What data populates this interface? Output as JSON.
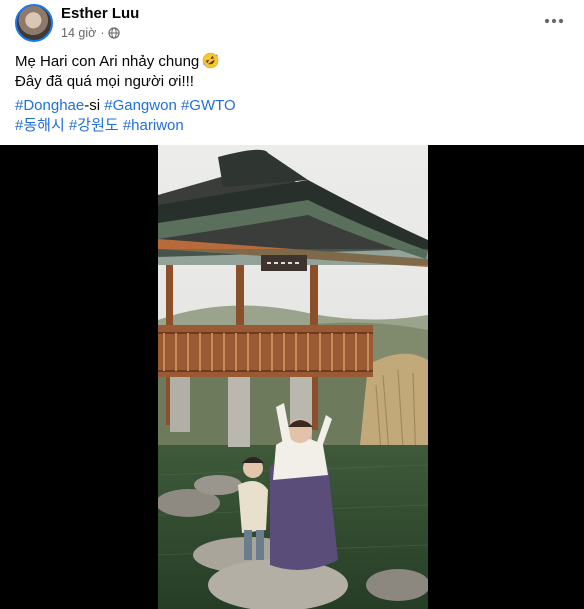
{
  "post": {
    "author": "Esther Luu",
    "time": "14 giờ",
    "separator": "·",
    "privacy_icon": "globe-icon",
    "menu_icon": "more-options-icon",
    "caption_line1": "Mẹ Hari con Ari nhảy chung",
    "caption_emoji": "rolling-on-floor-laughing-emoji",
    "caption_line2": "Đây đã quá mọi người ơi!!!",
    "hashtags_row1": {
      "tag1": "#Donghae",
      "tag1_suffix": "-si",
      "tag2": "#Gangwon",
      "tag3": "#GWTO"
    },
    "hashtags_row2": {
      "tag1": "#동해시",
      "tag2": "#강원도",
      "tag3": "#hariwon"
    }
  },
  "colors": {
    "link": "#216fdb",
    "meta_text": "#65676b",
    "avatar_ring": "#1877f2",
    "video_background": "#000000"
  }
}
